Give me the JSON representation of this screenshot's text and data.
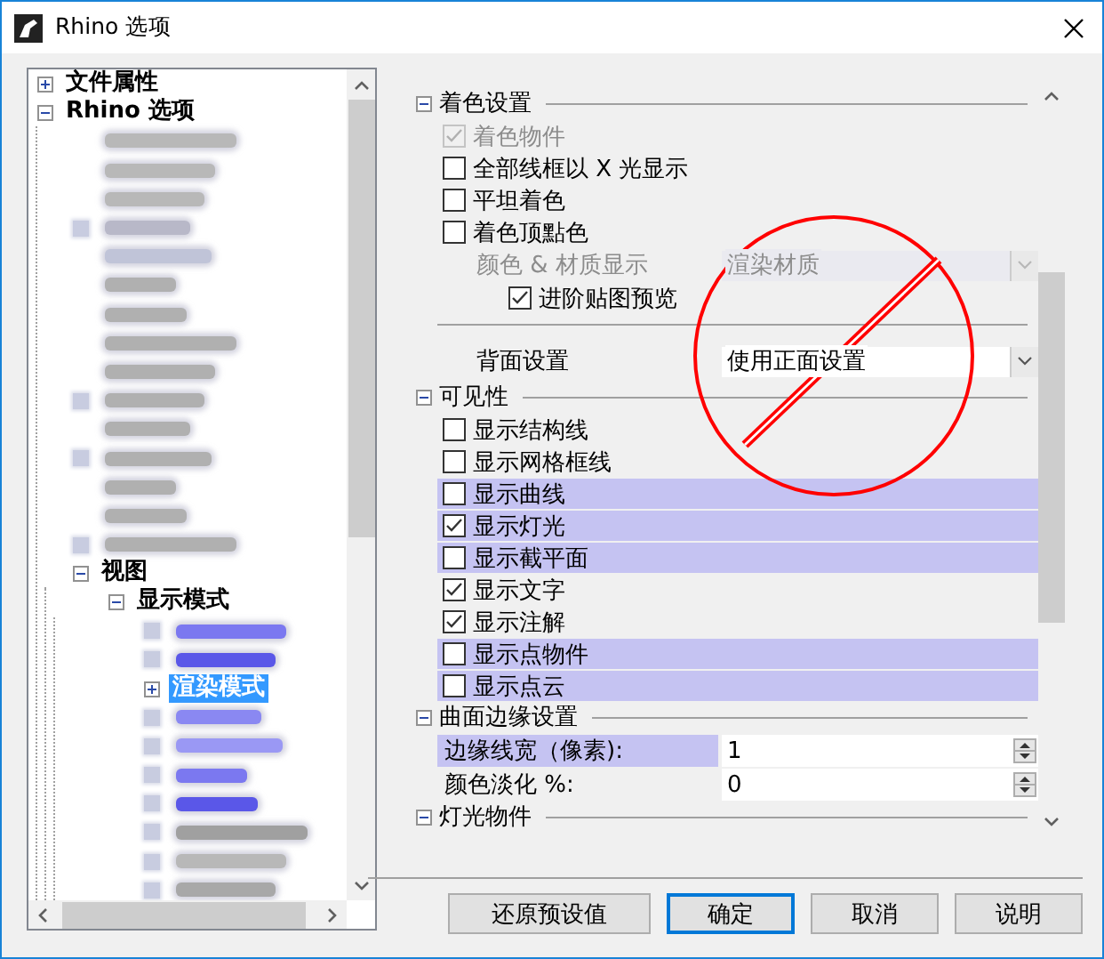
{
  "window": {
    "title": "Rhino 选项"
  },
  "tree": [
    {
      "label": "文件属性",
      "expanded": false,
      "selected": false
    },
    {
      "label": "Rhino 选项",
      "expanded": true,
      "selected": false,
      "children": [
        {
          "kind": "redacted",
          "expander": false,
          "color": "#b8b8b8"
        },
        {
          "kind": "redacted",
          "expander": false,
          "color": "#b8b8b8"
        },
        {
          "kind": "redacted",
          "expander": false,
          "color": "#b8b8b8"
        },
        {
          "kind": "redacted",
          "expander": true,
          "color": "#b8b8c8"
        },
        {
          "kind": "redacted",
          "expander": false,
          "color": "#c0c4d8"
        },
        {
          "kind": "redacted",
          "expander": false,
          "color": "#b0b0b0"
        },
        {
          "kind": "redacted",
          "expander": false,
          "color": "#b0b0b0"
        },
        {
          "kind": "redacted",
          "expander": false,
          "color": "#b0b0b0"
        },
        {
          "kind": "redacted",
          "expander": false,
          "color": "#b0b0b0"
        },
        {
          "kind": "redacted",
          "expander": true,
          "color": "#b0b0b0"
        },
        {
          "kind": "redacted",
          "expander": false,
          "color": "#b0b0b0"
        },
        {
          "kind": "redacted",
          "expander": true,
          "color": "#b0b0b0"
        },
        {
          "kind": "redacted",
          "expander": false,
          "color": "#b0b0b0"
        },
        {
          "kind": "redacted",
          "expander": false,
          "color": "#b0b0b0"
        },
        {
          "kind": "redacted",
          "expander": true,
          "color": "#b0b0b0"
        },
        {
          "label": "视图",
          "expanded": true,
          "selected": false,
          "children": [
            {
              "label": "显示模式",
              "expanded": true,
              "selected": false,
              "children": [
                {
                  "kind": "redacted",
                  "expander": true,
                  "color": "#7b78f0"
                },
                {
                  "kind": "redacted",
                  "expander": true,
                  "color": "#5a57e8"
                },
                {
                  "label": "渲染模式",
                  "expanded": false,
                  "selected": true
                },
                {
                  "kind": "redacted",
                  "expander": true,
                  "color": "#8a88f2"
                },
                {
                  "kind": "redacted",
                  "expander": true,
                  "color": "#9a98f4"
                },
                {
                  "kind": "redacted",
                  "expander": true,
                  "color": "#7b78f0"
                },
                {
                  "kind": "redacted",
                  "expander": true,
                  "color": "#5a57e8"
                },
                {
                  "kind": "redacted",
                  "expander": true,
                  "color": "#a0a0a0"
                },
                {
                  "kind": "redacted",
                  "expander": true,
                  "color": "#b8b8b8"
                },
                {
                  "kind": "redacted",
                  "expander": true,
                  "color": "#a8a8a8"
                }
              ]
            }
          ]
        }
      ]
    }
  ],
  "sections": [
    {
      "title": "着色设置",
      "expanded": true,
      "rows": [
        {
          "kind": "check",
          "label": "着色物件",
          "checked": true,
          "disabled": true,
          "highlighted": false
        },
        {
          "kind": "check",
          "label": "全部线框以 X 光显示",
          "checked": false,
          "disabled": false,
          "highlighted": false
        },
        {
          "kind": "check",
          "label": "平坦着色",
          "checked": false,
          "disabled": false,
          "highlighted": false
        },
        {
          "kind": "check",
          "label": "着色顶點色",
          "checked": false,
          "disabled": false,
          "highlighted": false
        },
        {
          "kind": "combo",
          "label": "颜色 & 材质显示",
          "value": "渲染材质",
          "disabled": true
        },
        {
          "kind": "subcheck",
          "label": "进阶贴图预览",
          "checked": true,
          "disabled": false,
          "highlighted": false
        },
        {
          "kind": "separator"
        },
        {
          "kind": "combo",
          "label": "背面设置",
          "value": "使用正面设置",
          "disabled": false
        }
      ]
    },
    {
      "title": "可见性",
      "expanded": true,
      "rows": [
        {
          "kind": "check",
          "label": "显示结构线",
          "checked": false,
          "disabled": false,
          "highlighted": false
        },
        {
          "kind": "check",
          "label": "显示网格框线",
          "checked": false,
          "disabled": false,
          "highlighted": false
        },
        {
          "kind": "check",
          "label": "显示曲线",
          "checked": false,
          "disabled": false,
          "highlighted": true
        },
        {
          "kind": "check",
          "label": "显示灯光",
          "checked": true,
          "disabled": false,
          "highlighted": true
        },
        {
          "kind": "check",
          "label": "显示截平面",
          "checked": false,
          "disabled": false,
          "highlighted": true
        },
        {
          "kind": "check",
          "label": "显示文字",
          "checked": true,
          "disabled": false,
          "highlighted": false
        },
        {
          "kind": "check",
          "label": "显示注解",
          "checked": true,
          "disabled": false,
          "highlighted": false
        },
        {
          "kind": "check",
          "label": "显示点物件",
          "checked": false,
          "disabled": false,
          "highlighted": true
        },
        {
          "kind": "check",
          "label": "显示点云",
          "checked": false,
          "disabled": false,
          "highlighted": true
        }
      ]
    },
    {
      "title": "曲面边缘设置",
      "expanded": true,
      "rows": [
        {
          "kind": "spinner",
          "label": "边缘线宽（像素):",
          "value": "1",
          "highlighted": true
        },
        {
          "kind": "spinner",
          "label": "颜色淡化 %:",
          "value": "0",
          "highlighted": false
        }
      ]
    },
    {
      "title": "灯光物件",
      "expanded": true
    }
  ],
  "buttons": [
    {
      "label": "还原预设值",
      "default": false
    },
    {
      "label": "确定",
      "default": true
    },
    {
      "label": "取消",
      "default": false
    },
    {
      "label": "说明",
      "default": false
    }
  ]
}
